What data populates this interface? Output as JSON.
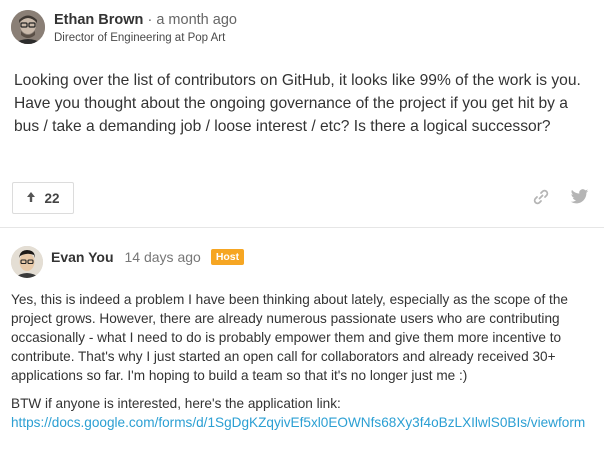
{
  "post": {
    "author": "Ethan Brown",
    "separator": "·",
    "time": "a month ago",
    "role": "Director of Engineering at Pop Art",
    "body": "Looking over the list of contributors on GitHub, it looks like 99% of the work is you. Have you thought about the ongoing governance of the project if you get hit by a bus / take a demanding job / loose interest / etc? Is there a logical successor?",
    "upvote_icon": "up-arrow-icon",
    "upvotes": "22",
    "share_icon": "link-icon",
    "tweet_icon": "twitter-icon"
  },
  "reply": {
    "author": "Evan You",
    "time": "14 days ago",
    "badge": "Host",
    "paragraph1": "Yes, this is indeed a problem I have been thinking about lately, especially as the scope of the project grows. However, there are already numerous passionate users who are contributing occasionally - what I need to do is probably empower them and give them more incentive to contribute. That's why I just started an open call for collaborators and already received 30+ applications so far. I'm hoping to build a team so that it's no longer just me :)",
    "paragraph2": "BTW if anyone is interested, here's the application link:",
    "link": "https://docs.google.com/forms/d/1SgDgKZqyivEf5xl0EOWNfs68Xy3f4oBzLXIlwlS0BIs/viewform"
  },
  "colors": {
    "badge_bg": "#f6a623",
    "link": "#2b9fd3",
    "divider": "#e6e6e6"
  }
}
